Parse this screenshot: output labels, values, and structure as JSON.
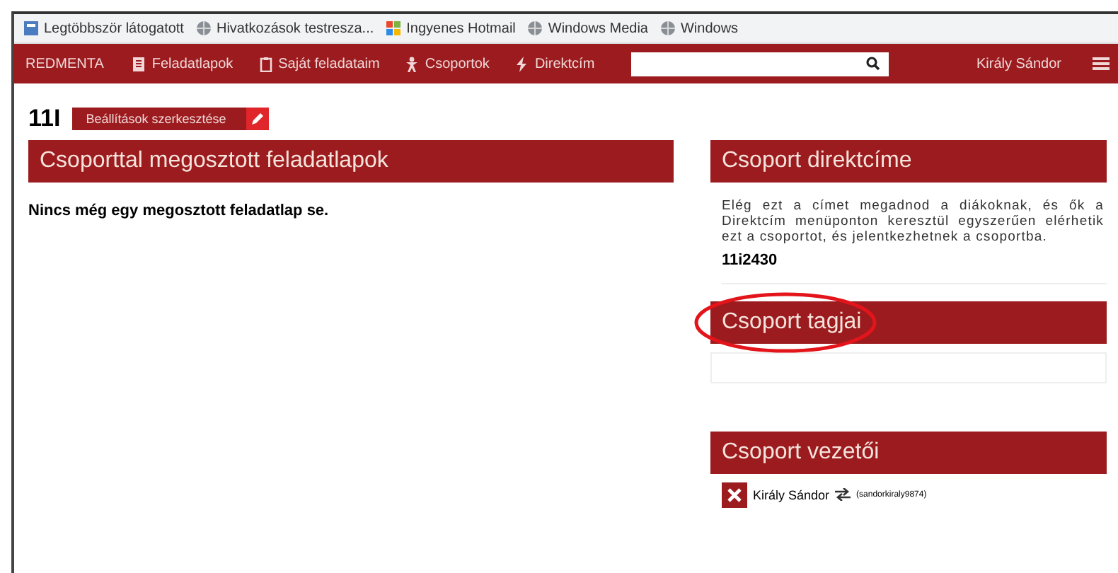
{
  "bookmarks": [
    {
      "label": "Legtöbbször látogatott",
      "kind": "page"
    },
    {
      "label": "Hivatkozások testresza...",
      "kind": "globe"
    },
    {
      "label": "Ingyenes Hotmail",
      "kind": "flag"
    },
    {
      "label": "Windows Media",
      "kind": "globe"
    },
    {
      "label": "Windows",
      "kind": "globe"
    }
  ],
  "nav": {
    "brand": "REDMENTA",
    "items": [
      {
        "label": "Feladatlapok",
        "kind": "sheet"
      },
      {
        "label": "Saját feladataim",
        "kind": "clipboard"
      },
      {
        "label": "Csoportok",
        "kind": "person"
      },
      {
        "label": "Direktcím",
        "kind": "bolt"
      }
    ],
    "user": "Király Sándor"
  },
  "group": {
    "name": "11I",
    "settings_button": "Beállítások szerkesztése"
  },
  "shared": {
    "title": "Csoporttal megosztott feladatlapok",
    "empty_text": "Nincs még egy megosztott feladatlap se."
  },
  "direct": {
    "title": "Csoport direktcíme",
    "description": "Elég ezt a címet megadnod a diákoknak, és ők a Direktcím menüponton keresztül egyszerűen elérhetik ezt a csoportot, és jelentkezhetnek a csoportba.",
    "code": "11i2430"
  },
  "members": {
    "title": "Csoport tagjai",
    "annotation": {
      "kind": "ellipse"
    }
  },
  "leaders": {
    "title": "Csoport vezetői",
    "items": [
      {
        "name": "Király Sándor",
        "username": "(sandorkiraly9874)"
      }
    ]
  }
}
